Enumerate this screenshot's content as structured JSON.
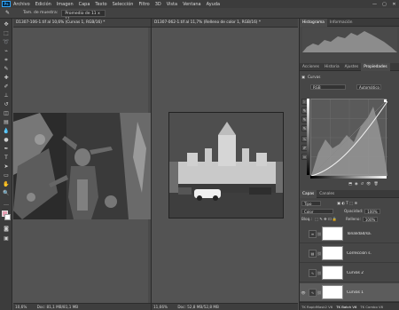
{
  "menubar": {
    "logo": "Ps",
    "items": [
      "Archivo",
      "Edición",
      "Imagen",
      "Capa",
      "Texto",
      "Selección",
      "Filtro",
      "3D",
      "Vista",
      "Ventana",
      "Ayuda"
    ],
    "window_buttons": [
      "—",
      "▢",
      "✕"
    ]
  },
  "options": {
    "label": "Tam. de muestra:",
    "value": "Promedio de 11 x 11"
  },
  "docA": {
    "tab": "D1307-106-1.tif al 10,6% (Curvas 1, RGB/16) *",
    "status": "10,6%",
    "status_doc": "Doc: 81,1 MB/81,1 MB"
  },
  "docB": {
    "tab": "D1307-062-1.tif al 11,7% (Relleno de color 1, RGB/16) *",
    "status": "11,66%",
    "status_doc": "Doc: 52,8 MB/52,8 MB"
  },
  "panels": {
    "top_tabs": [
      "Histograma",
      "Información"
    ],
    "mid_tabs": [
      "Acciones",
      "Historia",
      "Ajustes",
      "Propiedades"
    ],
    "properties_title": "Curvas",
    "channel": "RGB",
    "auto_label": "Automático",
    "layers_tabs": [
      "Capas",
      "Canales"
    ],
    "filter_label": "Tipo",
    "blend_mode": "Color",
    "opacity_label": "Opacidad:",
    "opacity_value": "100%",
    "lock_label": "Bloq.:",
    "fill_label": "Relleno:",
    "fill_value": "100%",
    "layers": [
      {
        "name": "Tonalidad/sa...",
        "icon": "≡"
      },
      {
        "name": "Corrección s...",
        "icon": "▤"
      },
      {
        "name": "Curvas 2",
        "icon": "∿"
      },
      {
        "name": "Curvas 1",
        "icon": "∿"
      }
    ],
    "bottom_tabs": [
      "TK RapidMask2 V6",
      "TK Batch V6",
      "TK Combo V6"
    ]
  }
}
